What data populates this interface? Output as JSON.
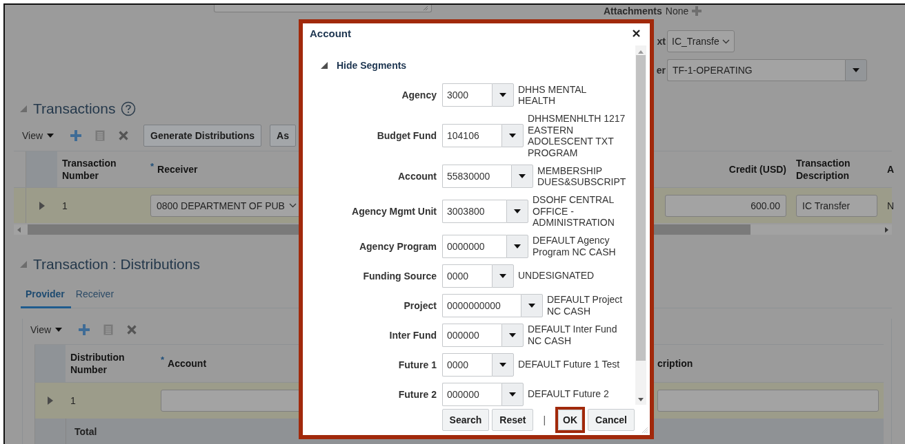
{
  "page": {
    "attachments": {
      "label": "Attachments",
      "value": "None"
    },
    "header_fields": [
      {
        "label": "xt",
        "value": "IC_Transfe",
        "kind": "choice"
      },
      {
        "label": "er",
        "value": "TF-1-OPERATING",
        "kind": "combo"
      }
    ],
    "transactions": {
      "title": "Transactions",
      "expanded": true,
      "view_menu": "View",
      "buttons": [
        "Generate Distributions",
        "As"
      ],
      "columns": [
        {
          "label": "Transaction Number",
          "kind": "plain"
        },
        {
          "label": "Receiver",
          "required_mark": "*",
          "kind": "choice"
        },
        {
          "label": "Credit (USD)",
          "kind": "amount"
        },
        {
          "label": "Transaction Description",
          "kind": "field"
        },
        {
          "label": "A",
          "kind": "plain"
        }
      ],
      "rows": [
        {
          "selected": true,
          "cells": [
            "1",
            "0800 DEPARTMENT OF PUB",
            "600.00",
            "IC Transfer",
            "N"
          ]
        }
      ]
    },
    "distributions": {
      "title": "Transaction : Distributions",
      "expanded": true,
      "tabs": [
        {
          "label": "Provider",
          "selected": true
        },
        {
          "label": "Receiver",
          "selected": false
        }
      ],
      "view_menu": "View",
      "columns": [
        {
          "label": "Distribution Number",
          "kind": "plain"
        },
        {
          "label": "Account",
          "required_mark": "*",
          "kind": "field"
        },
        {
          "label": "cription",
          "kind": "field"
        }
      ],
      "rows": [
        {
          "selected": true,
          "cells": [
            "1"
          ]
        }
      ],
      "total_label": "Total"
    }
  },
  "dialog": {
    "title": "Account",
    "segments_toggle": {
      "label": "Hide Segments",
      "expanded": true
    },
    "segments": [
      {
        "label": "Agency",
        "value": "3000",
        "description": "DHHS MENTAL HEALTH"
      },
      {
        "label": "Budget Fund",
        "value": "104106",
        "description": "DHHSMENHLTH 1217 EASTERN ADOLESCENT TXT PROGRAM"
      },
      {
        "label": "Account",
        "value": "55830000",
        "description": "MEMBERSHIP DUES&SUBSCRIPT"
      },
      {
        "label": "Agency Mgmt Unit",
        "value": "3003800",
        "description": "DSOHF CENTRAL OFFICE - ADMINISTRATION"
      },
      {
        "label": "Agency Program",
        "value": "0000000",
        "description": "DEFAULT Agency Program NC CASH"
      },
      {
        "label": "Funding Source",
        "value": "0000",
        "description": "UNDESIGNATED"
      },
      {
        "label": "Project",
        "value": "0000000000",
        "description": "DEFAULT Project NC CASH"
      },
      {
        "label": "Inter Fund",
        "value": "000000",
        "description": "DEFAULT Inter Fund NC CASH"
      },
      {
        "label": "Future 1",
        "value": "0000",
        "description": "DEFAULT Future 1 Test"
      },
      {
        "label": "Future 2",
        "value": "000000",
        "description": "DEFAULT Future 2"
      }
    ],
    "buttons": [
      {
        "label": "Search",
        "highlighted": false,
        "kind": "button"
      },
      {
        "label": "Reset",
        "highlighted": false,
        "kind": "button"
      },
      {
        "label": "|",
        "kind": "separator"
      },
      {
        "label": "OK",
        "highlighted": true,
        "kind": "button"
      },
      {
        "label": "Cancel",
        "highlighted": false,
        "kind": "button"
      }
    ]
  }
}
